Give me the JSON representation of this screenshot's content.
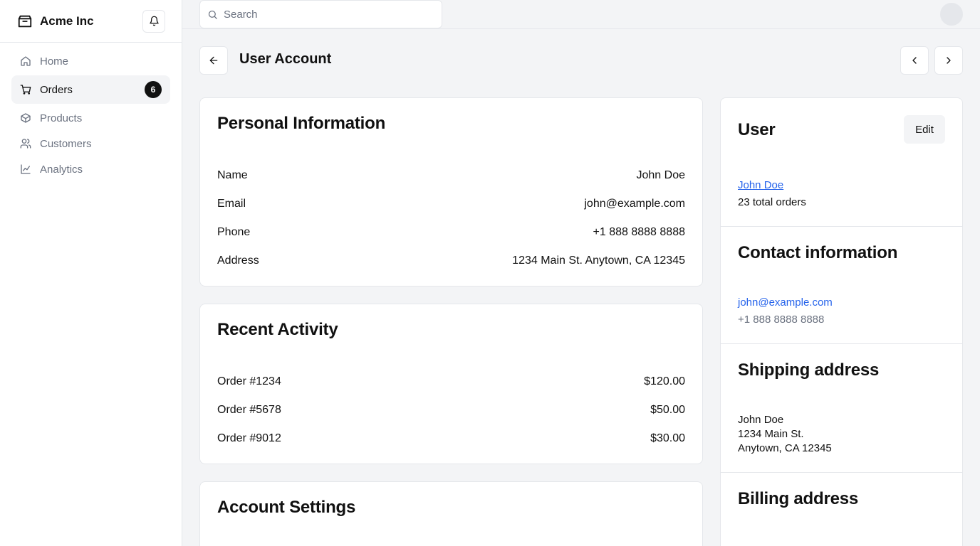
{
  "brand": {
    "name": "Acme Inc"
  },
  "sidebar": {
    "items": [
      {
        "label": "Home",
        "icon": "home-icon"
      },
      {
        "label": "Orders",
        "icon": "cart-icon",
        "badge": "6",
        "active": true
      },
      {
        "label": "Products",
        "icon": "package-icon"
      },
      {
        "label": "Customers",
        "icon": "users-icon"
      },
      {
        "label": "Analytics",
        "icon": "line-chart-icon"
      }
    ]
  },
  "search": {
    "placeholder": "Search",
    "value": ""
  },
  "header": {
    "title": "User Account"
  },
  "personal": {
    "title": "Personal Information",
    "rows": [
      {
        "label": "Name",
        "value": "John Doe"
      },
      {
        "label": "Email",
        "value": "john@example.com"
      },
      {
        "label": "Phone",
        "value": "+1 888 8888 8888"
      },
      {
        "label": "Address",
        "value": "1234 Main St. Anytown, CA 12345"
      }
    ]
  },
  "activity": {
    "title": "Recent Activity",
    "rows": [
      {
        "label": "Order #1234",
        "value": "$120.00"
      },
      {
        "label": "Order #5678",
        "value": "$50.00"
      },
      {
        "label": "Order #9012",
        "value": "$30.00"
      }
    ]
  },
  "settings": {
    "title": "Account Settings"
  },
  "user_panel": {
    "title": "User",
    "edit_label": "Edit",
    "name": "John Doe",
    "orders": "23 total orders"
  },
  "contact": {
    "title": "Contact information",
    "email": "john@example.com",
    "phone": "+1 888 8888 8888"
  },
  "shipping": {
    "title": "Shipping address",
    "line1": "John Doe",
    "line2": "1234 Main St.",
    "line3": "Anytown, CA 12345"
  },
  "billing": {
    "title": "Billing address"
  },
  "colors": {
    "link": "#2563eb",
    "badge": "#111111",
    "muted": "#6b7280"
  }
}
